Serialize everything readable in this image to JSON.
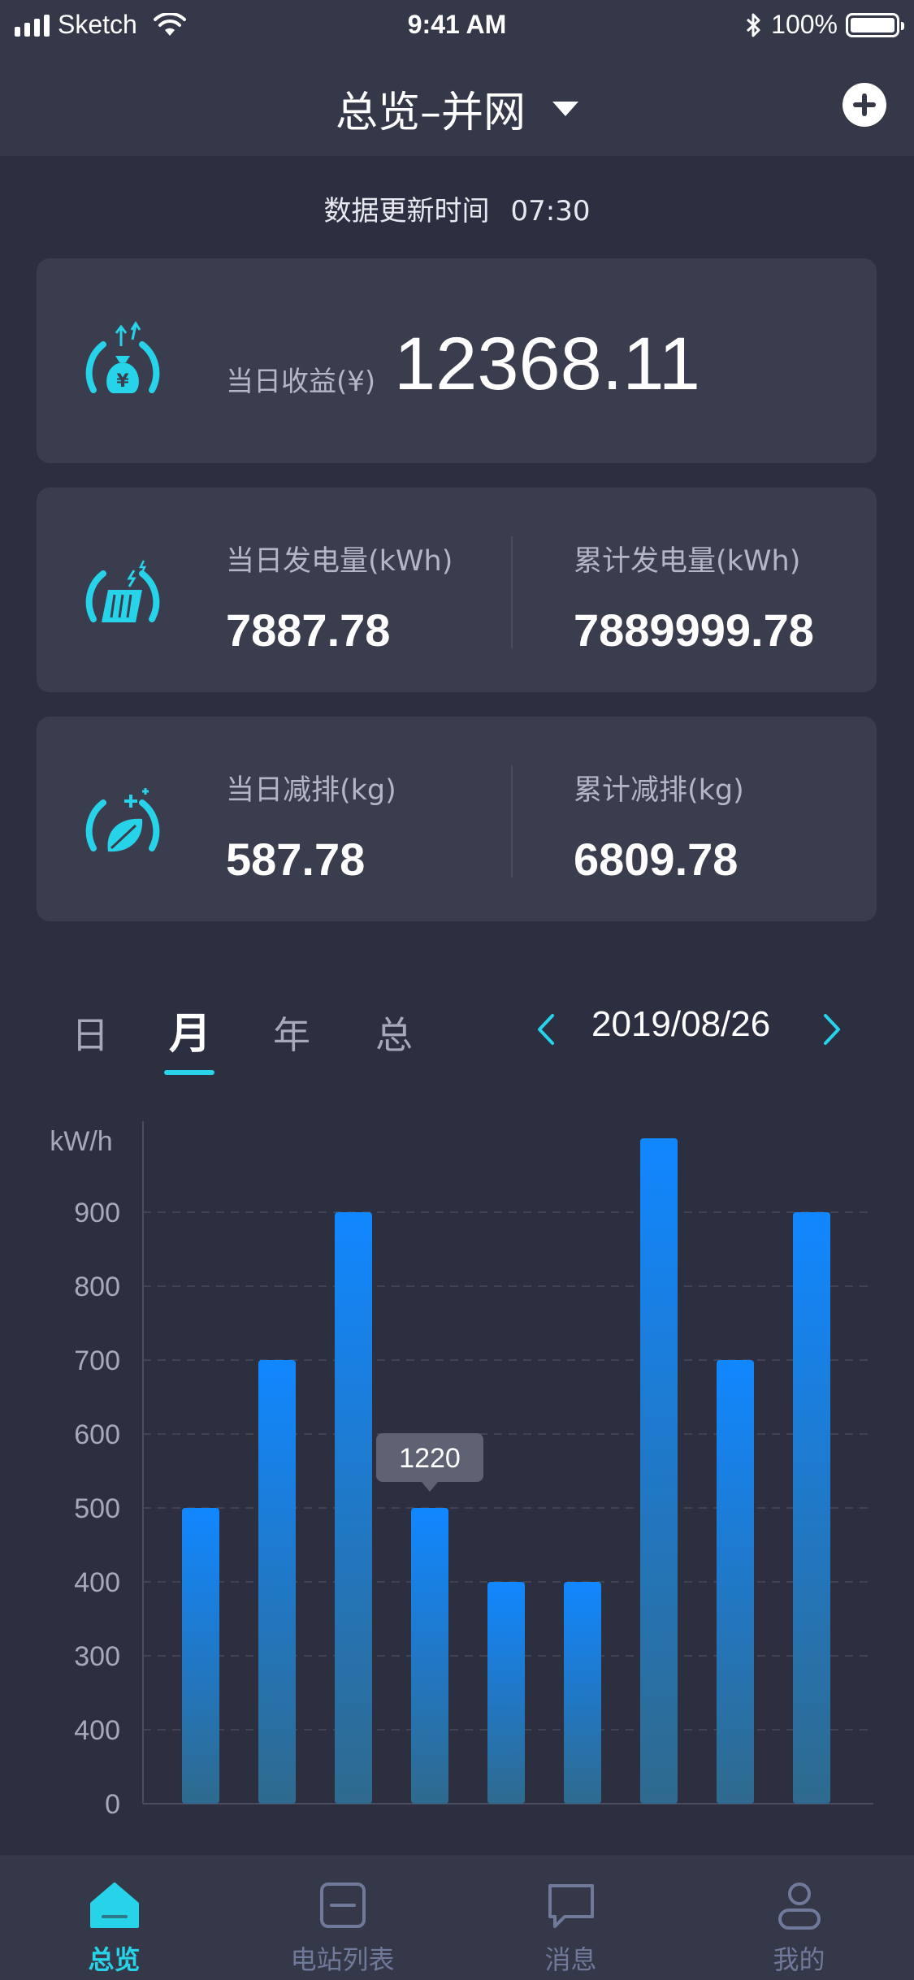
{
  "status_bar": {
    "carrier": "Sketch",
    "time": "9:41 AM",
    "battery": "100%"
  },
  "nav": {
    "title": "总览–并网",
    "icons": {
      "dropdown": "caret-down-icon",
      "add": "plus-circle-icon"
    }
  },
  "update": {
    "label": "数据更新时间",
    "time": "07:30"
  },
  "revenue": {
    "label": "当日收益(¥)",
    "value": "12368.11",
    "icon": "money-bag-gauge-icon"
  },
  "power": {
    "icon": "solar-panel-gauge-icon",
    "today_label": "当日发电量(kWh)",
    "today_value": "7887.78",
    "total_label": "累计发电量(kWh)",
    "total_value": "7889999.78"
  },
  "emission": {
    "icon": "leaf-gauge-icon",
    "today_label": "当日减排(kg)",
    "today_value": "587.78",
    "total_label": "累计减排(kg)",
    "total_value": "6809.78"
  },
  "period_tabs": [
    "日",
    "月",
    "年",
    "总"
  ],
  "active_tab": 1,
  "date": "2019/08/26",
  "colors": {
    "accent": "#27d3e8",
    "bar_top": "#1187ff",
    "bar_bottom": "#2f6a8e",
    "card": "#3a3d4e",
    "background": "#2c2f3f"
  },
  "chart_data": {
    "type": "bar",
    "ylabel": "kW/h",
    "ytick_labels": [
      "0",
      "400",
      "300",
      "400",
      "500",
      "600",
      "700",
      "800",
      "900"
    ],
    "ylim": [
      0,
      1000
    ],
    "grid": true,
    "values": [
      400,
      600,
      800,
      400,
      300,
      300,
      900,
      600,
      800
    ],
    "tooltip": {
      "bar_index": 3,
      "text": "1220"
    }
  },
  "tabbar": [
    {
      "label": "总览",
      "icon": "home-icon",
      "active": true
    },
    {
      "label": "电站列表",
      "icon": "list-icon",
      "active": false
    },
    {
      "label": "消息",
      "icon": "message-icon",
      "active": false
    },
    {
      "label": "我的",
      "icon": "user-icon",
      "active": false
    }
  ]
}
